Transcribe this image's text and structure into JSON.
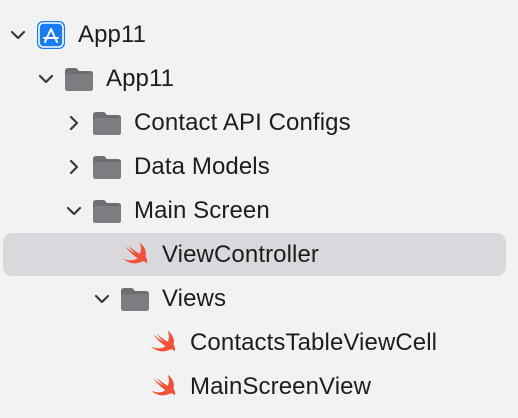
{
  "navigator": {
    "items": [
      {
        "label": "App11",
        "icon": "xcode-project-icon",
        "expanded": true
      },
      {
        "label": "App11",
        "icon": "folder-icon",
        "expanded": true
      },
      {
        "label": "Contact API Configs",
        "icon": "folder-icon",
        "expanded": false
      },
      {
        "label": "Data Models",
        "icon": "folder-icon",
        "expanded": false
      },
      {
        "label": "Main Screen",
        "icon": "folder-icon",
        "expanded": true
      },
      {
        "label": "ViewController",
        "icon": "swift-file-icon",
        "selected": true
      },
      {
        "label": "Views",
        "icon": "folder-icon",
        "expanded": true
      },
      {
        "label": "ContactsTableViewCell",
        "icon": "swift-file-icon"
      },
      {
        "label": "MainScreenView",
        "icon": "swift-file-icon"
      }
    ]
  },
  "colors": {
    "selection": "#d9d9dd",
    "folder": "#6e6e73",
    "project_blue": "#1a7cf3",
    "swift_orange": "#f05138",
    "text": "#1d1d1f"
  }
}
